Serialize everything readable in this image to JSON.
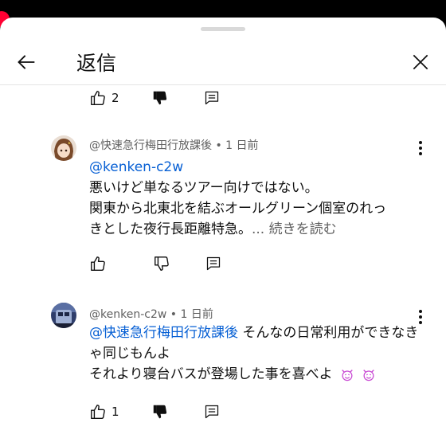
{
  "header": {
    "title": "返信"
  },
  "top_actions": {
    "like_count": "2"
  },
  "comments": [
    {
      "author": "@快速急行梅田行放課後",
      "separator": "•",
      "time": "1 日前",
      "mention": "@kenken-c2w",
      "line1": "悪いけど単なるツアー向けではない。",
      "line2": "関東から北東北を結ぶオールグリーン個室のれっ",
      "line3": "きとした夜行長距離特急。",
      "more": "... 続きを読む",
      "like_count": ""
    },
    {
      "author": "@kenken-c2w",
      "separator": "•",
      "time": "1 日前",
      "mention": "@快速急行梅田行放課後",
      "line1_rest": " そんなの日常利用ができなきゃ同じもんよ",
      "line2": "それより寝台バスが登場した事を喜べよ",
      "like_count": "1"
    }
  ],
  "colors": {
    "accent": "#065fd4",
    "emoji": "#c94bd4",
    "live_dot": "#ff0033"
  },
  "icons": [
    "back-arrow-icon",
    "close-icon",
    "thumbs-up-icon",
    "thumbs-down-icon",
    "reply-icon",
    "more-vert-icon",
    "smiling-imp-emoji-icon"
  ]
}
